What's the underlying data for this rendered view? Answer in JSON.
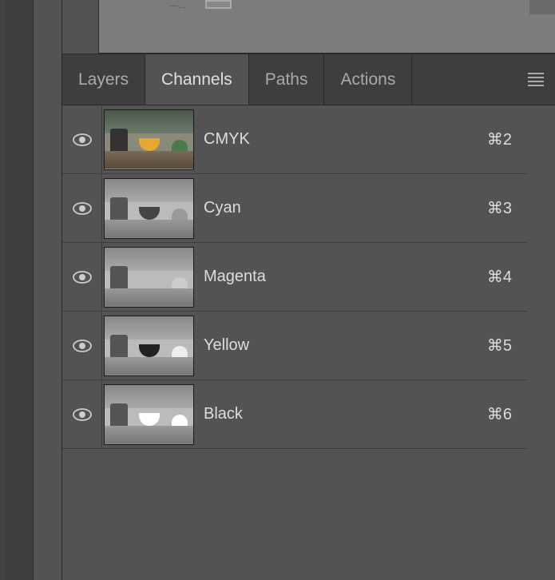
{
  "tabs": {
    "layers": "Layers",
    "channels": "Channels",
    "paths": "Paths",
    "actions": "Actions",
    "active": "channels"
  },
  "channels": [
    {
      "name": "CMYK",
      "shortcut": "⌘2",
      "type": "composite"
    },
    {
      "name": "Cyan",
      "shortcut": "⌘3",
      "type": "cyan"
    },
    {
      "name": "Magenta",
      "shortcut": "⌘4",
      "type": "magenta"
    },
    {
      "name": "Yellow",
      "shortcut": "⌘5",
      "type": "yellow"
    },
    {
      "name": "Black",
      "shortcut": "⌘6",
      "type": "black"
    }
  ],
  "top_ellipsis": "—…"
}
